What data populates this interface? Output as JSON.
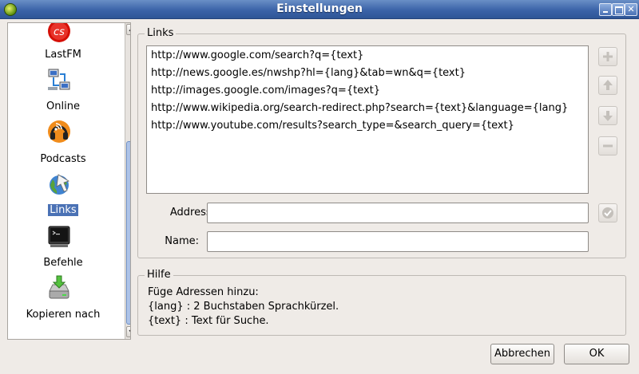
{
  "window": {
    "title": "Einstellungen"
  },
  "sidebar": {
    "items": [
      {
        "label": "LastFM",
        "icon": "lastfm-icon"
      },
      {
        "label": "Online",
        "icon": "network-icon"
      },
      {
        "label": "Podcasts",
        "icon": "podcast-icon"
      },
      {
        "label": "Links",
        "icon": "links-globe-icon",
        "selected": true
      },
      {
        "label": "Befehle",
        "icon": "terminal-icon"
      },
      {
        "label": "Kopieren nach",
        "icon": "copy-to-drive-icon"
      }
    ]
  },
  "links": {
    "group_title": "Links",
    "items": [
      "http://www.google.com/search?q={text}",
      "http://news.google.es/nwshp?hl={lang}&tab=wn&q={text}",
      "http://images.google.com/images?q={text}",
      "http://www.wikipedia.org/search-redirect.php?search={text}&language={lang}",
      "http://www.youtube.com/results?search_type=&search_query={text}"
    ],
    "address_label": "Addresse:",
    "address_value": "",
    "name_label": "Name:",
    "name_value": ""
  },
  "help": {
    "group_title": "Hilfe",
    "lines": [
      "Füge Adressen hinzu:",
      "{lang} : 2 Buchstaben Sprachkürzel.",
      "{text} : Text für Suche."
    ]
  },
  "buttons": {
    "cancel_label": "Abbrechen",
    "ok_label": "OK"
  }
}
